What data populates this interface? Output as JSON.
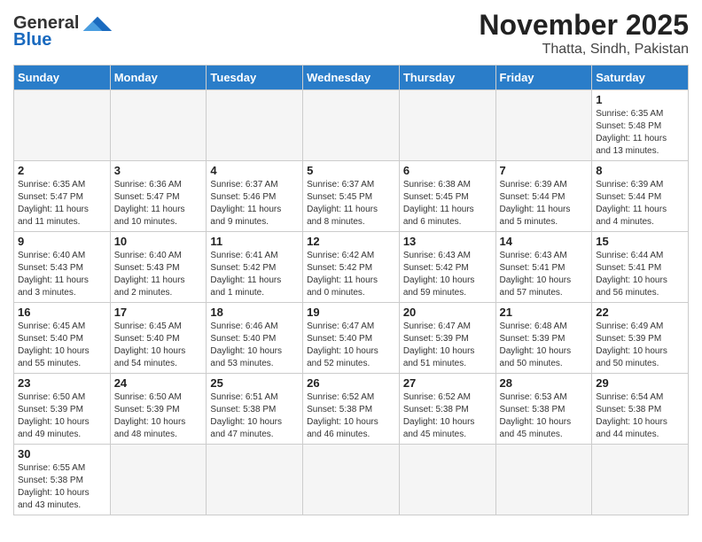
{
  "logo": {
    "text_general": "General",
    "text_blue": "Blue"
  },
  "title": "November 2025",
  "subtitle": "Thatta, Sindh, Pakistan",
  "days_of_week": [
    "Sunday",
    "Monday",
    "Tuesday",
    "Wednesday",
    "Thursday",
    "Friday",
    "Saturday"
  ],
  "weeks": [
    [
      {
        "day": "",
        "info": ""
      },
      {
        "day": "",
        "info": ""
      },
      {
        "day": "",
        "info": ""
      },
      {
        "day": "",
        "info": ""
      },
      {
        "day": "",
        "info": ""
      },
      {
        "day": "",
        "info": ""
      },
      {
        "day": "1",
        "info": "Sunrise: 6:35 AM\nSunset: 5:48 PM\nDaylight: 11 hours\nand 13 minutes."
      }
    ],
    [
      {
        "day": "2",
        "info": "Sunrise: 6:35 AM\nSunset: 5:47 PM\nDaylight: 11 hours\nand 11 minutes."
      },
      {
        "day": "3",
        "info": "Sunrise: 6:36 AM\nSunset: 5:47 PM\nDaylight: 11 hours\nand 10 minutes."
      },
      {
        "day": "4",
        "info": "Sunrise: 6:37 AM\nSunset: 5:46 PM\nDaylight: 11 hours\nand 9 minutes."
      },
      {
        "day": "5",
        "info": "Sunrise: 6:37 AM\nSunset: 5:45 PM\nDaylight: 11 hours\nand 8 minutes."
      },
      {
        "day": "6",
        "info": "Sunrise: 6:38 AM\nSunset: 5:45 PM\nDaylight: 11 hours\nand 6 minutes."
      },
      {
        "day": "7",
        "info": "Sunrise: 6:39 AM\nSunset: 5:44 PM\nDaylight: 11 hours\nand 5 minutes."
      },
      {
        "day": "8",
        "info": "Sunrise: 6:39 AM\nSunset: 5:44 PM\nDaylight: 11 hours\nand 4 minutes."
      }
    ],
    [
      {
        "day": "9",
        "info": "Sunrise: 6:40 AM\nSunset: 5:43 PM\nDaylight: 11 hours\nand 3 minutes."
      },
      {
        "day": "10",
        "info": "Sunrise: 6:40 AM\nSunset: 5:43 PM\nDaylight: 11 hours\nand 2 minutes."
      },
      {
        "day": "11",
        "info": "Sunrise: 6:41 AM\nSunset: 5:42 PM\nDaylight: 11 hours\nand 1 minute."
      },
      {
        "day": "12",
        "info": "Sunrise: 6:42 AM\nSunset: 5:42 PM\nDaylight: 11 hours\nand 0 minutes."
      },
      {
        "day": "13",
        "info": "Sunrise: 6:43 AM\nSunset: 5:42 PM\nDaylight: 10 hours\nand 59 minutes."
      },
      {
        "day": "14",
        "info": "Sunrise: 6:43 AM\nSunset: 5:41 PM\nDaylight: 10 hours\nand 57 minutes."
      },
      {
        "day": "15",
        "info": "Sunrise: 6:44 AM\nSunset: 5:41 PM\nDaylight: 10 hours\nand 56 minutes."
      }
    ],
    [
      {
        "day": "16",
        "info": "Sunrise: 6:45 AM\nSunset: 5:40 PM\nDaylight: 10 hours\nand 55 minutes."
      },
      {
        "day": "17",
        "info": "Sunrise: 6:45 AM\nSunset: 5:40 PM\nDaylight: 10 hours\nand 54 minutes."
      },
      {
        "day": "18",
        "info": "Sunrise: 6:46 AM\nSunset: 5:40 PM\nDaylight: 10 hours\nand 53 minutes."
      },
      {
        "day": "19",
        "info": "Sunrise: 6:47 AM\nSunset: 5:40 PM\nDaylight: 10 hours\nand 52 minutes."
      },
      {
        "day": "20",
        "info": "Sunrise: 6:47 AM\nSunset: 5:39 PM\nDaylight: 10 hours\nand 51 minutes."
      },
      {
        "day": "21",
        "info": "Sunrise: 6:48 AM\nSunset: 5:39 PM\nDaylight: 10 hours\nand 50 minutes."
      },
      {
        "day": "22",
        "info": "Sunrise: 6:49 AM\nSunset: 5:39 PM\nDaylight: 10 hours\nand 50 minutes."
      }
    ],
    [
      {
        "day": "23",
        "info": "Sunrise: 6:50 AM\nSunset: 5:39 PM\nDaylight: 10 hours\nand 49 minutes."
      },
      {
        "day": "24",
        "info": "Sunrise: 6:50 AM\nSunset: 5:39 PM\nDaylight: 10 hours\nand 48 minutes."
      },
      {
        "day": "25",
        "info": "Sunrise: 6:51 AM\nSunset: 5:38 PM\nDaylight: 10 hours\nand 47 minutes."
      },
      {
        "day": "26",
        "info": "Sunrise: 6:52 AM\nSunset: 5:38 PM\nDaylight: 10 hours\nand 46 minutes."
      },
      {
        "day": "27",
        "info": "Sunrise: 6:52 AM\nSunset: 5:38 PM\nDaylight: 10 hours\nand 45 minutes."
      },
      {
        "day": "28",
        "info": "Sunrise: 6:53 AM\nSunset: 5:38 PM\nDaylight: 10 hours\nand 45 minutes."
      },
      {
        "day": "29",
        "info": "Sunrise: 6:54 AM\nSunset: 5:38 PM\nDaylight: 10 hours\nand 44 minutes."
      }
    ],
    [
      {
        "day": "30",
        "info": "Sunrise: 6:55 AM\nSunset: 5:38 PM\nDaylight: 10 hours\nand 43 minutes."
      },
      {
        "day": "",
        "info": ""
      },
      {
        "day": "",
        "info": ""
      },
      {
        "day": "",
        "info": ""
      },
      {
        "day": "",
        "info": ""
      },
      {
        "day": "",
        "info": ""
      },
      {
        "day": "",
        "info": ""
      }
    ]
  ]
}
